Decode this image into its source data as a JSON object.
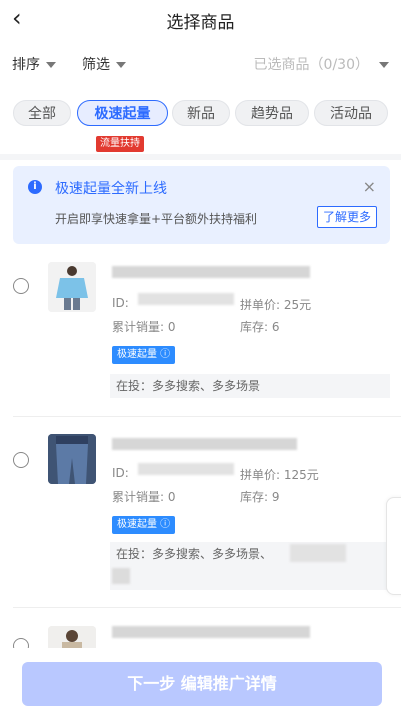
{
  "nav": {
    "back_icon": "‹",
    "title": "选择商品"
  },
  "filters": {
    "sort": "排序",
    "filter": "筛选",
    "selected": "已选商品（0/30）"
  },
  "tabs": [
    "全部",
    "极速起量",
    "新品",
    "趋势品",
    "活动品"
  ],
  "tab_badge": "流量扶持",
  "notice": {
    "title": "极速起量全新上线",
    "desc": "开启即享快速拿量+平台额外扶持福利",
    "more": "了解更多",
    "close": "×"
  },
  "products": [
    {
      "id_label": "ID:",
      "price_label": "拼单价:",
      "price": "25元",
      "sales_label": "累计销量:",
      "sales": "0",
      "stock_label": "库存:",
      "stock": "6",
      "badge": "极速起量 ⓘ",
      "placed": "在投：多多搜索、多多场景"
    },
    {
      "id_label": "ID:",
      "price_label": "拼单价:",
      "price": "125元",
      "sales_label": "累计销量:",
      "sales": "0",
      "stock_label": "库存:",
      "stock": "9",
      "badge": "极速起量 ⓘ",
      "placed": "在投：多多搜索、多多场景、"
    }
  ],
  "next_button": "下一步 编辑推广详情"
}
